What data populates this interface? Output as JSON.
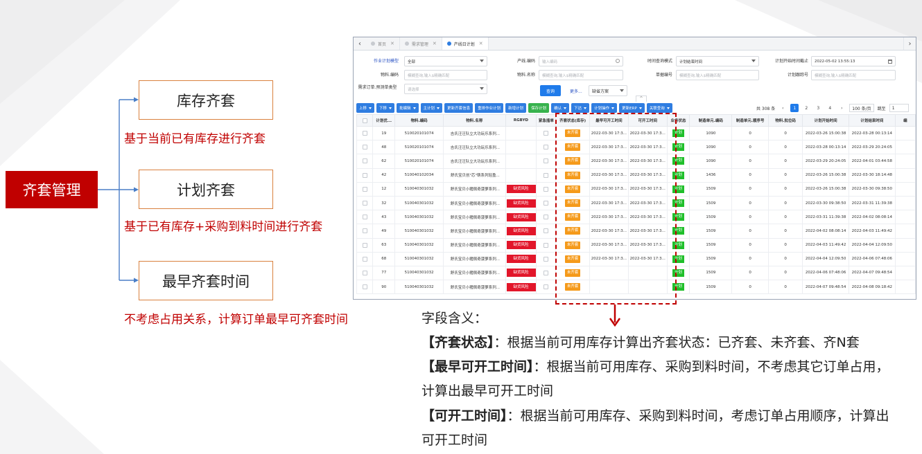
{
  "mindmap": {
    "root": "齐套管理",
    "branches": [
      {
        "title": "库存齐套",
        "desc": "基于当前已有库存进行齐套"
      },
      {
        "title": "计划齐套",
        "desc": "基于已有库存+采购到料时间进行齐套"
      },
      {
        "title": "最早齐套时间",
        "desc": "不考虑占用关系，计算订单最早可齐套时间"
      }
    ]
  },
  "app": {
    "nav_prev": "‹",
    "nav_next": "›",
    "tabs": [
      {
        "label": "首页",
        "active": false
      },
      {
        "label": "需求管理",
        "active": false
      },
      {
        "label": "产线日计划",
        "active": true
      }
    ],
    "filters": {
      "work_plan_model_label": "作业计划模型",
      "work_plan_model_value": "全部",
      "line_code_label": "产线.编码",
      "line_code_placeholder": "输入编码",
      "time_mode_label": "时间查询模式",
      "time_mode_value": "计划结束时间",
      "plan_start_deadline_label": "计划开始时间截止",
      "plan_start_deadline_value": "2022-05-02 13:55:13",
      "material_code_label": "物料.编码",
      "material_code_placeholder": "模糊查询,输入$精确匹配",
      "material_name_label": "物料.名称",
      "material_name_placeholder": "模糊查询,输入$精确匹配",
      "doc_no_label": "单据编号",
      "doc_no_placeholder": "模糊查询,输入$精确匹配",
      "plan_trace_label": "计划跟踪号",
      "plan_trace_placeholder": "模糊查询,输入$精确匹配",
      "demand_type_label": "需求订单.预测单类型",
      "demand_type_placeholder": "请选择",
      "query_button": "查询",
      "more_link": "更多...",
      "scheme_value": "缺省方案",
      "collapse_glyph": "^"
    },
    "toolbar": [
      {
        "label": "上移",
        "dropdown": true,
        "color": "blue"
      },
      {
        "label": "下移",
        "dropdown": true,
        "color": "blue"
      },
      {
        "label": "批编辑",
        "dropdown": true,
        "color": "blue"
      },
      {
        "label": "主计划",
        "dropdown": true,
        "color": "blue"
      },
      {
        "label": "更新齐套信息",
        "dropdown": false,
        "color": "blue"
      },
      {
        "label": "重排作业计划",
        "dropdown": false,
        "color": "blue"
      },
      {
        "label": "新增计划",
        "dropdown": false,
        "color": "blue"
      },
      {
        "label": "保存计划",
        "dropdown": false,
        "color": "green"
      },
      {
        "label": "确认",
        "dropdown": true,
        "color": "blue"
      },
      {
        "label": "下达",
        "dropdown": true,
        "color": "blue"
      },
      {
        "label": "计划操作",
        "dropdown": true,
        "color": "blue"
      },
      {
        "label": "更新ERP",
        "dropdown": true,
        "color": "blue"
      },
      {
        "label": "关联查询",
        "dropdown": true,
        "color": "blue"
      }
    ],
    "pager": {
      "total": "共 308 条",
      "prev": "‹",
      "pages": [
        "1",
        "2",
        "3",
        "4"
      ],
      "active_page": "1",
      "next": "›",
      "size": "100 条/页",
      "jump_label": "跳至",
      "jump_value": "1"
    },
    "table": {
      "columns": [
        "",
        "计划优...",
        "物料.编码",
        "物料.名称",
        "RGBYD",
        "紧急插单",
        "齐套状态(库存)",
        "最早可开工时间",
        "可开工时间",
        "业务状态",
        "制造单元.编码",
        "制造单元.顺序号",
        "物料.批位码",
        "计划开始时间",
        "计划结束时间",
        "编"
      ],
      "rows": [
        {
          "seq": "19",
          "code": "510020101074",
          "name": "吉氏汪汪队立大功玩乐系列...",
          "risk": "",
          "kit": "未齐套",
          "earliest": "2022-03-30 17:3...",
          "start": "2022-03-30 17:3...",
          "color": "red",
          "status": "计划",
          "unit": "1090",
          "order": "0",
          "batch": "0",
          "pstart": "2022-03-26 15:00:38",
          "pend": "2022-03-28 00:13:14"
        },
        {
          "seq": "48",
          "code": "510020101074",
          "name": "吉氏汪汪队立大功玩乐系列...",
          "risk": "",
          "kit": "未齐套",
          "earliest": "2022-03-30 17:3...",
          "start": "2022-03-30 17:3...",
          "color": "red",
          "status": "计划",
          "unit": "1090",
          "order": "0",
          "batch": "0",
          "pstart": "2022-03-28 00:13:14",
          "pend": "2022-03-29 20:24:05"
        },
        {
          "seq": "62",
          "code": "510020101074",
          "name": "吉氏汪汪队立大功玩乐系列...",
          "risk": "",
          "kit": "未齐套",
          "earliest": "2022-03-30 17:3...",
          "start": "2022-03-30 17:3...",
          "color": "red",
          "status": "计划",
          "unit": "1090",
          "order": "0",
          "batch": "0",
          "pstart": "2022-03-29 20:24:05",
          "pend": "2022-04-01 03:44:58"
        },
        {
          "seq": "42",
          "code": "510040102034",
          "name": "舒氏宝贝创\"芯\"萌系列轻盈...",
          "risk": "",
          "kit": "未齐套",
          "earliest": "2022-03-30 17:3...",
          "start": "2022-03-30 17:3...",
          "color": "red",
          "status": "计划",
          "unit": "1436",
          "order": "0",
          "batch": "0",
          "pstart": "2022-03-26 15:00:38",
          "pend": "2022-03-30 18:14:48"
        },
        {
          "seq": "12",
          "code": "510040301032",
          "name": "舒氏宝贝小猪佩奇菠萝系列...",
          "risk": "缺货风险",
          "kit": "未齐套",
          "earliest": "2022-03-30 17:3...",
          "start": "2022-03-30 17:3...",
          "color": "red",
          "status": "计划",
          "unit": "1509",
          "order": "0",
          "batch": "0",
          "pstart": "2022-03-26 15:00:38",
          "pend": "2022-03-30 09:38:50"
        },
        {
          "seq": "32",
          "code": "510040301032",
          "name": "舒氏宝贝小猪佩奇菠萝系列...",
          "risk": "缺货风险",
          "kit": "未齐套",
          "earliest": "2022-03-30 17:3...",
          "start": "2022-03-30 17:3...",
          "color": "red",
          "status": "计划",
          "unit": "1509",
          "order": "0",
          "batch": "0",
          "pstart": "2022-03-30 09:38:50",
          "pend": "2022-03-31 11:39:38"
        },
        {
          "seq": "43",
          "code": "510040301032",
          "name": "舒氏宝贝小猪佩奇菠萝系列...",
          "risk": "缺货风险",
          "kit": "未齐套",
          "earliest": "2022-03-30 17:3...",
          "start": "2022-03-30 17:3...",
          "color": "green",
          "status": "计划",
          "unit": "1509",
          "order": "0",
          "batch": "0",
          "pstart": "2022-03-31 11:39:38",
          "pend": "2022-04-02 08:08:14"
        },
        {
          "seq": "49",
          "code": "510040301032",
          "name": "舒氏宝贝小猪佩奇菠萝系列...",
          "risk": "缺货风险",
          "kit": "未齐套",
          "earliest": "2022-03-30 17:3...",
          "start": "2022-03-30 17:3...",
          "color": "green",
          "status": "计划",
          "unit": "1509",
          "order": "0",
          "batch": "0",
          "pstart": "2022-04-02 08:08:14",
          "pend": "2022-04-03 11:49:42"
        },
        {
          "seq": "63",
          "code": "510040301032",
          "name": "舒氏宝贝小猪佩奇菠萝系列...",
          "risk": "缺货风险",
          "kit": "未齐套",
          "earliest": "2022-03-30 17:3...",
          "start": "2022-03-30 17:3...",
          "color": "green",
          "status": "计划",
          "unit": "1509",
          "order": "0",
          "batch": "0",
          "pstart": "2022-04-03 11:49:42",
          "pend": "2022-04-04 12:09:50"
        },
        {
          "seq": "68",
          "code": "510040301032",
          "name": "舒氏宝贝小猪佩奇菠萝系列...",
          "risk": "缺货风险",
          "kit": "未齐套",
          "earliest": "2022-03-30 17:3...",
          "start": "2022-03-30 17:3...",
          "color": "green",
          "status": "计划",
          "unit": "1509",
          "order": "0",
          "batch": "0",
          "pstart": "2022-04-04 12:09:50",
          "pend": "2022-04-06 07:48:06"
        },
        {
          "seq": "77",
          "code": "510040301032",
          "name": "舒氏宝贝小猪佩奇菠萝系列...",
          "risk": "缺货风险",
          "kit": "未齐套",
          "earliest": "",
          "start": "",
          "color": "green",
          "status": "计划",
          "unit": "1509",
          "order": "0",
          "batch": "0",
          "pstart": "2022-04-06 07:48:06",
          "pend": "2022-04-07 09:48:54"
        },
        {
          "seq": "90",
          "code": "510040301032",
          "name": "舒氏宝贝小猪佩奇菠萝系列...",
          "risk": "缺货风险",
          "kit": "未齐套",
          "earliest": "",
          "start": "",
          "color": "green",
          "status": "计划",
          "unit": "1509",
          "order": "0",
          "batch": "0",
          "pstart": "2022-04-07 09:48:54",
          "pend": "2022-04-08 09:18:42"
        }
      ]
    }
  },
  "explain": {
    "heading": "字段含义：",
    "items": [
      {
        "term": "【齐套状态】",
        "text": "：根据当前可用库存计算出齐套状态：已齐套、未齐套、齐N套"
      },
      {
        "term": "【最早可开工时间】",
        "text": "：根据当前可用库存、采购到料时间，不考虑其它订单占用，"
      },
      {
        "term": "",
        "text": "计算出最早可开工时间"
      },
      {
        "term": "【可开工时间】",
        "text": "：根据当前可用库存、采购到料时间，考虑订单占用顺序，计算出"
      },
      {
        "term": "",
        "text": "可开工时间"
      }
    ]
  },
  "colors": {
    "accent_red": "#c00000",
    "primary_blue": "#2f7de1",
    "risk_red": "#e2162a",
    "kit_orange": "#f59a1a",
    "status_green": "#1fbf2a"
  }
}
